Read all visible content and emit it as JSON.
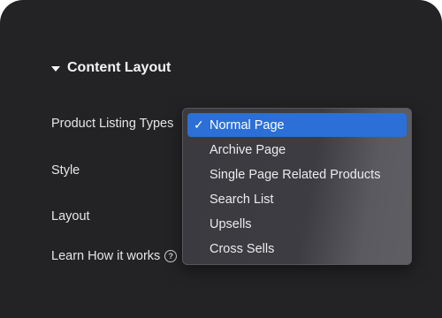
{
  "section": {
    "title": "Content Layout"
  },
  "rows": {
    "product_listing_types": "Product Listing Types",
    "style": "Style",
    "layout": "Layout",
    "learn": "Learn How it works",
    "help_icon_glyph": "?"
  },
  "dropdown": {
    "check_glyph": "✓",
    "selected_index": 0,
    "options": [
      "Normal Page",
      "Archive Page",
      "Single Page Related Products",
      "Search List",
      "Upsells",
      "Cross Sells"
    ]
  },
  "colors": {
    "panel_bg": "#232326",
    "selection": "#2c6fd6",
    "text": "#ececee"
  }
}
